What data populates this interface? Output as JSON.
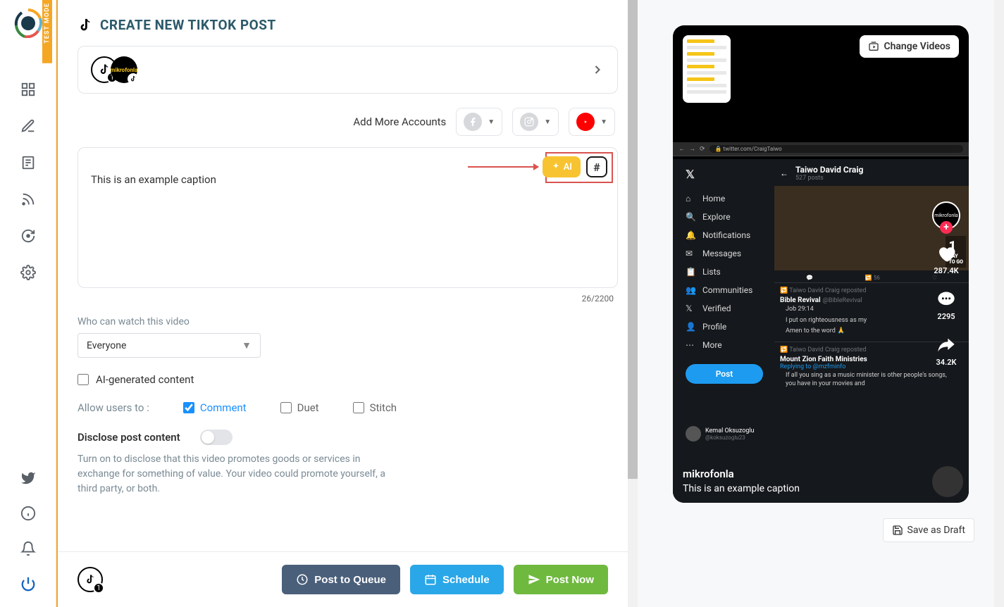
{
  "testMode": "TEST MODE",
  "pageTitle": "CREATE NEW TIKTOK POST",
  "accountBadge": "1",
  "addMoreAccounts": "Add More Accounts",
  "captionText": "This is an example caption",
  "aiLabel": "AI",
  "hashLabel": "#",
  "charCount": "26/2200",
  "watchLabel": "Who can watch this video",
  "watchValue": "Everyone",
  "aiGenerated": "AI-generated content",
  "allowLabel": "Allow users to :",
  "allow": {
    "comment": "Comment",
    "duet": "Duet",
    "stitch": "Stitch"
  },
  "discloseLabel": "Disclose post content",
  "discloseHelp": "Turn on to disclose that this video promotes goods or services in exchange for something of value. Your video could promote yourself, a third party, or both.",
  "footer": {
    "queue": "Post to Queue",
    "schedule": "Schedule",
    "post": "Post Now",
    "badge": "1"
  },
  "preview": {
    "changeVideos": "Change Videos",
    "saveDraft": "Save as Draft",
    "url": "twitter.com/CraigTaiwo",
    "nav": [
      "Home",
      "Explore",
      "Notifications",
      "Messages",
      "Lists",
      "Communities",
      "Verified",
      "Profile",
      "More"
    ],
    "postBtn": "Post",
    "profile": {
      "name": "Taiwo David Craig",
      "posts": "527 posts"
    },
    "feed": {
      "repost1": "Taiwo David Craig reposted",
      "name1": "Bible Revival",
      "handle1": "@BibleRevival",
      "body1a": "Job 29:14",
      "body1b": "I put on righteousness as my",
      "body1c": "Amen to the word 🙏",
      "repost2": "Taiwo David Craig reposted",
      "name2": "Mount Zion Faith Ministries",
      "reply2": "Replying to @mzfminfo",
      "body2": "If all you sing as a music minister is other people's songs, you have in your movies and",
      "user3": "Kemal Oksuzoglu",
      "handle3": "@koksuzoglu23"
    },
    "tk": {
      "likes": "287.4K",
      "comments": "2295",
      "shares": "34.2K",
      "avatar": "mikrofonla",
      "user": "mikrofonla",
      "caption": "This is an example caption"
    }
  }
}
